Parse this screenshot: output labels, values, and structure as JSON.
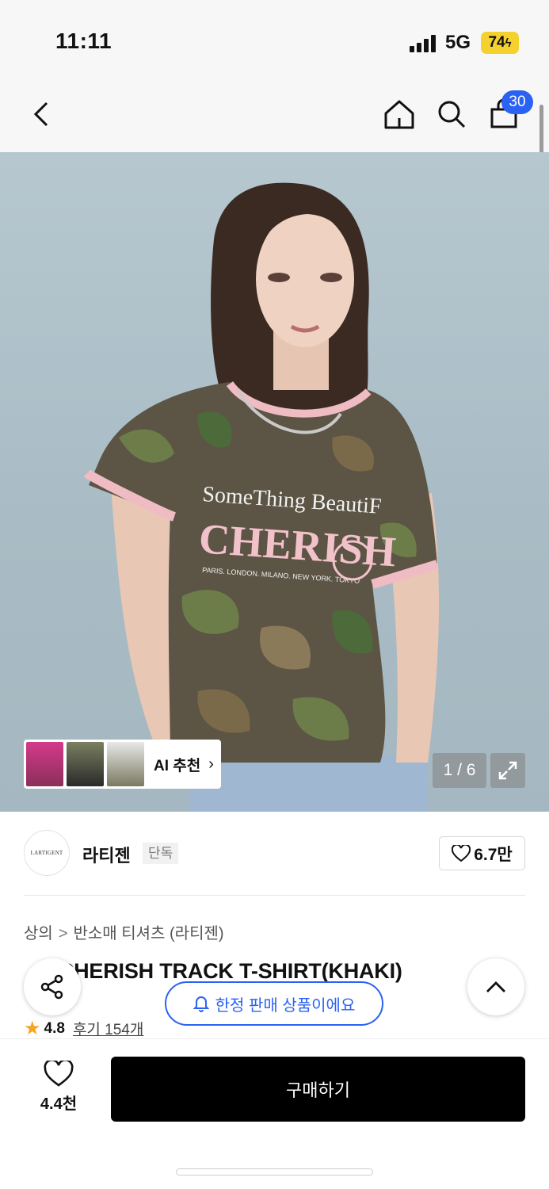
{
  "status_bar": {
    "time": "11:11",
    "network": "5G",
    "battery": "74"
  },
  "header": {
    "cart_count": "30"
  },
  "gallery": {
    "artwork": {
      "line1": "SomeThing BeautiF",
      "line2": "CHERISH",
      "line3": "PARIS. LONDON. MILANO. NEW YORK. TOKYO"
    },
    "ai_label": "AI 추천",
    "page": "1 / 6"
  },
  "brand": {
    "logo_text": "LARTIGENT",
    "name": "라티젠",
    "badge": "단독",
    "likes": "6.7만"
  },
  "breadcrumb": {
    "category": "상의",
    "subcategory": "반소매 티셔츠 (라티젠)"
  },
  "product": {
    "title": "CHERISH TRACK T-SHIRT(KHAKI)",
    "rating": "4.8",
    "reviews": "후기 154개"
  },
  "notice": {
    "limited": "한정 판매 상품이에요"
  },
  "bottom_bar": {
    "wish_count": "4.4천",
    "buy_label": "구매하기"
  },
  "colors": {
    "accent": "#2a62f3",
    "buy_button": "#000000",
    "star": "#f7a51c",
    "battery": "#f5d130"
  }
}
